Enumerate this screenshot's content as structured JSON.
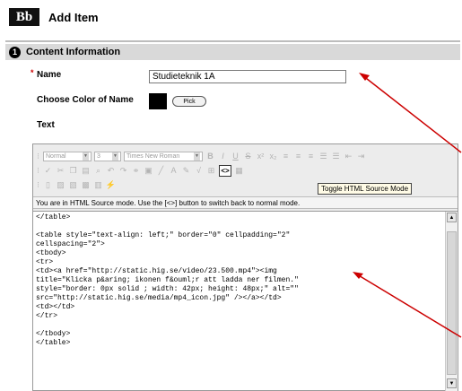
{
  "header": {
    "logo": "Bb",
    "title": "Add Item"
  },
  "section": {
    "step": "1",
    "title": "Content Information"
  },
  "form": {
    "name_label": "Name",
    "required_mark": "*",
    "name_value": "Studieteknik 1A",
    "color_label": "Choose Color of Name",
    "pick_label": "Pick",
    "text_label": "Text"
  },
  "editor": {
    "format_select": "Normal",
    "size_select": "3",
    "font_select": "Times New Roman",
    "source_button": "<>",
    "tooltip": "Toggle HTML Source Mode",
    "mode_message": "You are in HTML Source mode. Use the [<>] button to switch back to normal mode.",
    "code_lines": [
      "</table>",
      "",
      "<table style=\"text-align: left;\" border=\"0\" cellpadding=\"2\"",
      "cellspacing=\"2\">",
      "<tbody>",
      "<tr>",
      "<td><a href=\"http://static.hig.se/video/23.500.mp4\"><img",
      "title=\"Klicka p&aring; ikonen f&ouml;r att ladda ner filmen.\"",
      "style=\"border: 0px solid ; width: 42px; height: 48px;\" alt=\"\"",
      "src=\"http://static.hig.se/media/mp4_icon.jpg\" /></a></td>",
      "<td></td>",
      "</tr>",
      "",
      "</tbody>",
      "</table>"
    ]
  },
  "colors": {
    "arrow": "#cc0000",
    "section_bar": "#d9d9d9",
    "required": "#cc0000"
  }
}
